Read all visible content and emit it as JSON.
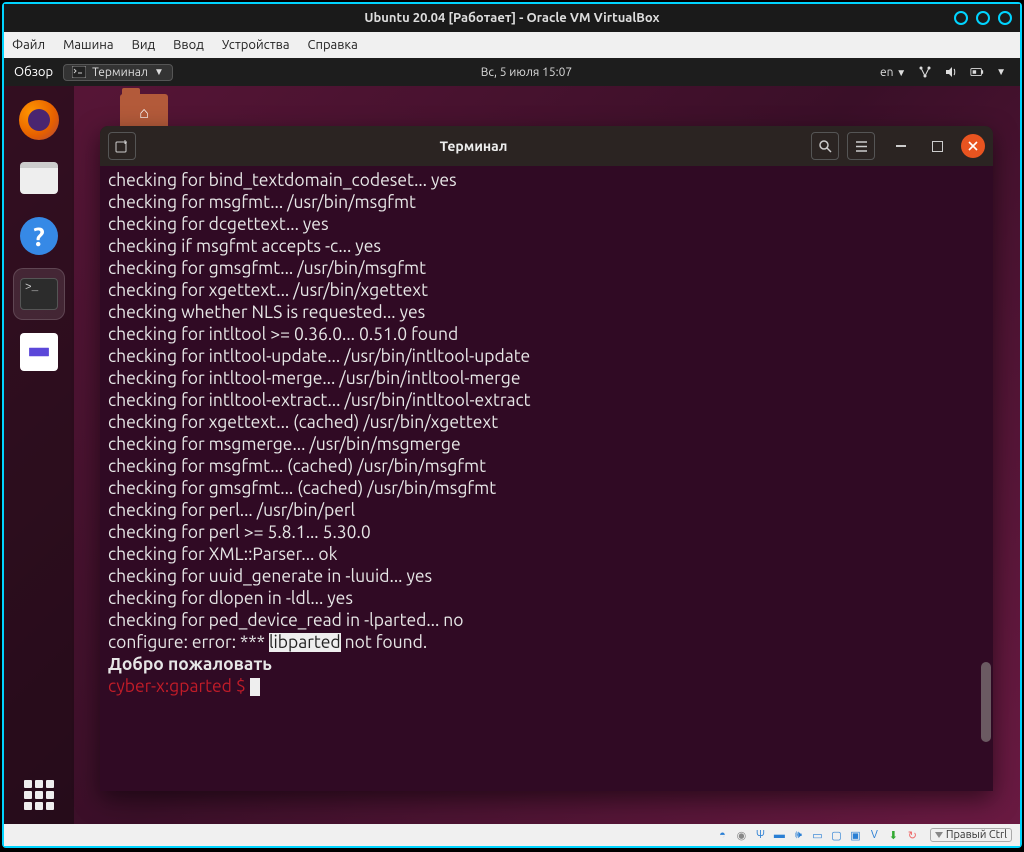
{
  "vbox": {
    "title": "Ubuntu 20.04 [Работает] - Oracle VM VirtualBox",
    "menu": [
      "Файл",
      "Машина",
      "Вид",
      "Ввод",
      "Устройства",
      "Справка"
    ],
    "host_key": "Правый Ctrl"
  },
  "gnome": {
    "mode": "Обзор",
    "app_dropdown_icon": "terminal-icon",
    "app_dropdown_label": "Терминал",
    "clock": "Вс, 5 июля  15:07",
    "lang": "en"
  },
  "dock": {
    "items": [
      {
        "name": "firefox",
        "active": false
      },
      {
        "name": "files",
        "active": false
      },
      {
        "name": "help",
        "active": false
      },
      {
        "name": "terminal",
        "active": true
      },
      {
        "name": "text-editor",
        "active": false
      }
    ]
  },
  "term": {
    "title": "Терминал",
    "lines": [
      "checking for bind_textdomain_codeset... yes",
      "checking for msgfmt... /usr/bin/msgfmt",
      "checking for dcgettext... yes",
      "checking if msgfmt accepts -c... yes",
      "checking for gmsgfmt... /usr/bin/msgfmt",
      "checking for xgettext... /usr/bin/xgettext",
      "checking whether NLS is requested... yes",
      "checking for intltool >= 0.36.0... 0.51.0 found",
      "checking for intltool-update... /usr/bin/intltool-update",
      "checking for intltool-merge... /usr/bin/intltool-merge",
      "checking for intltool-extract... /usr/bin/intltool-extract",
      "checking for xgettext... (cached) /usr/bin/xgettext",
      "checking for msgmerge... /usr/bin/msgmerge",
      "checking for msgfmt... (cached) /usr/bin/msgfmt",
      "checking for gmsgfmt... (cached) /usr/bin/msgfmt",
      "checking for perl... /usr/bin/perl",
      "checking for perl >= 5.8.1... 5.30.0",
      "checking for XML::Parser... ok",
      "checking for uuid_generate in -luuid... yes",
      "checking for dlopen in -ldl... yes",
      "checking for ped_device_read in -lparted... no"
    ],
    "error_prefix": "configure: error: *** ",
    "error_highlight": "libparted",
    "error_suffix": " not found.",
    "welcome": "Добро пожаловать",
    "prompt_user": "cyber-x",
    "prompt_sep": ":",
    "prompt_path": "gparted",
    "prompt_sym": " $ "
  },
  "status_icons": [
    "hdd",
    "cd",
    "usb",
    "audio",
    "net",
    "display",
    "record",
    "clipboard",
    "drag",
    "mouse"
  ]
}
